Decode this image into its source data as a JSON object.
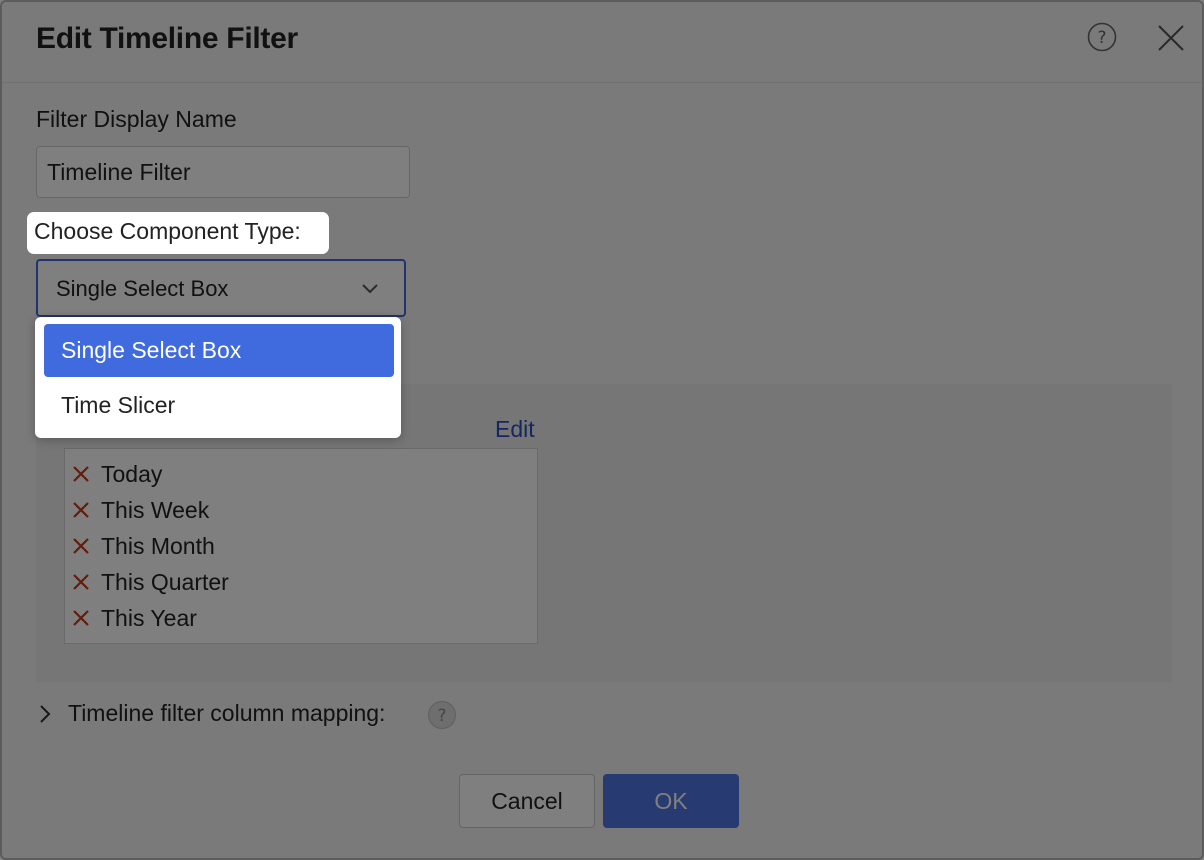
{
  "dialog": {
    "title": "Edit Timeline Filter",
    "close_icon": "close-icon",
    "help_icon": "help-icon"
  },
  "display_name": {
    "label": "Filter Display Name",
    "value": "Timeline Filter"
  },
  "component_type": {
    "label": "Choose Component Type:",
    "selected": "Single Select Box",
    "options": [
      "Single Select Box",
      "Time Slicer"
    ]
  },
  "periods": {
    "edit_label": "Edit",
    "items": [
      "Today",
      "This Week",
      "This Month",
      "This Quarter",
      "This Year"
    ]
  },
  "mapping": {
    "label": "Timeline filter column mapping:"
  },
  "footer": {
    "cancel_label": "Cancel",
    "ok_label": "OK"
  },
  "colors": {
    "accent": "#3f6bde",
    "link": "#2b4fc0",
    "remove": "#c0391b"
  }
}
